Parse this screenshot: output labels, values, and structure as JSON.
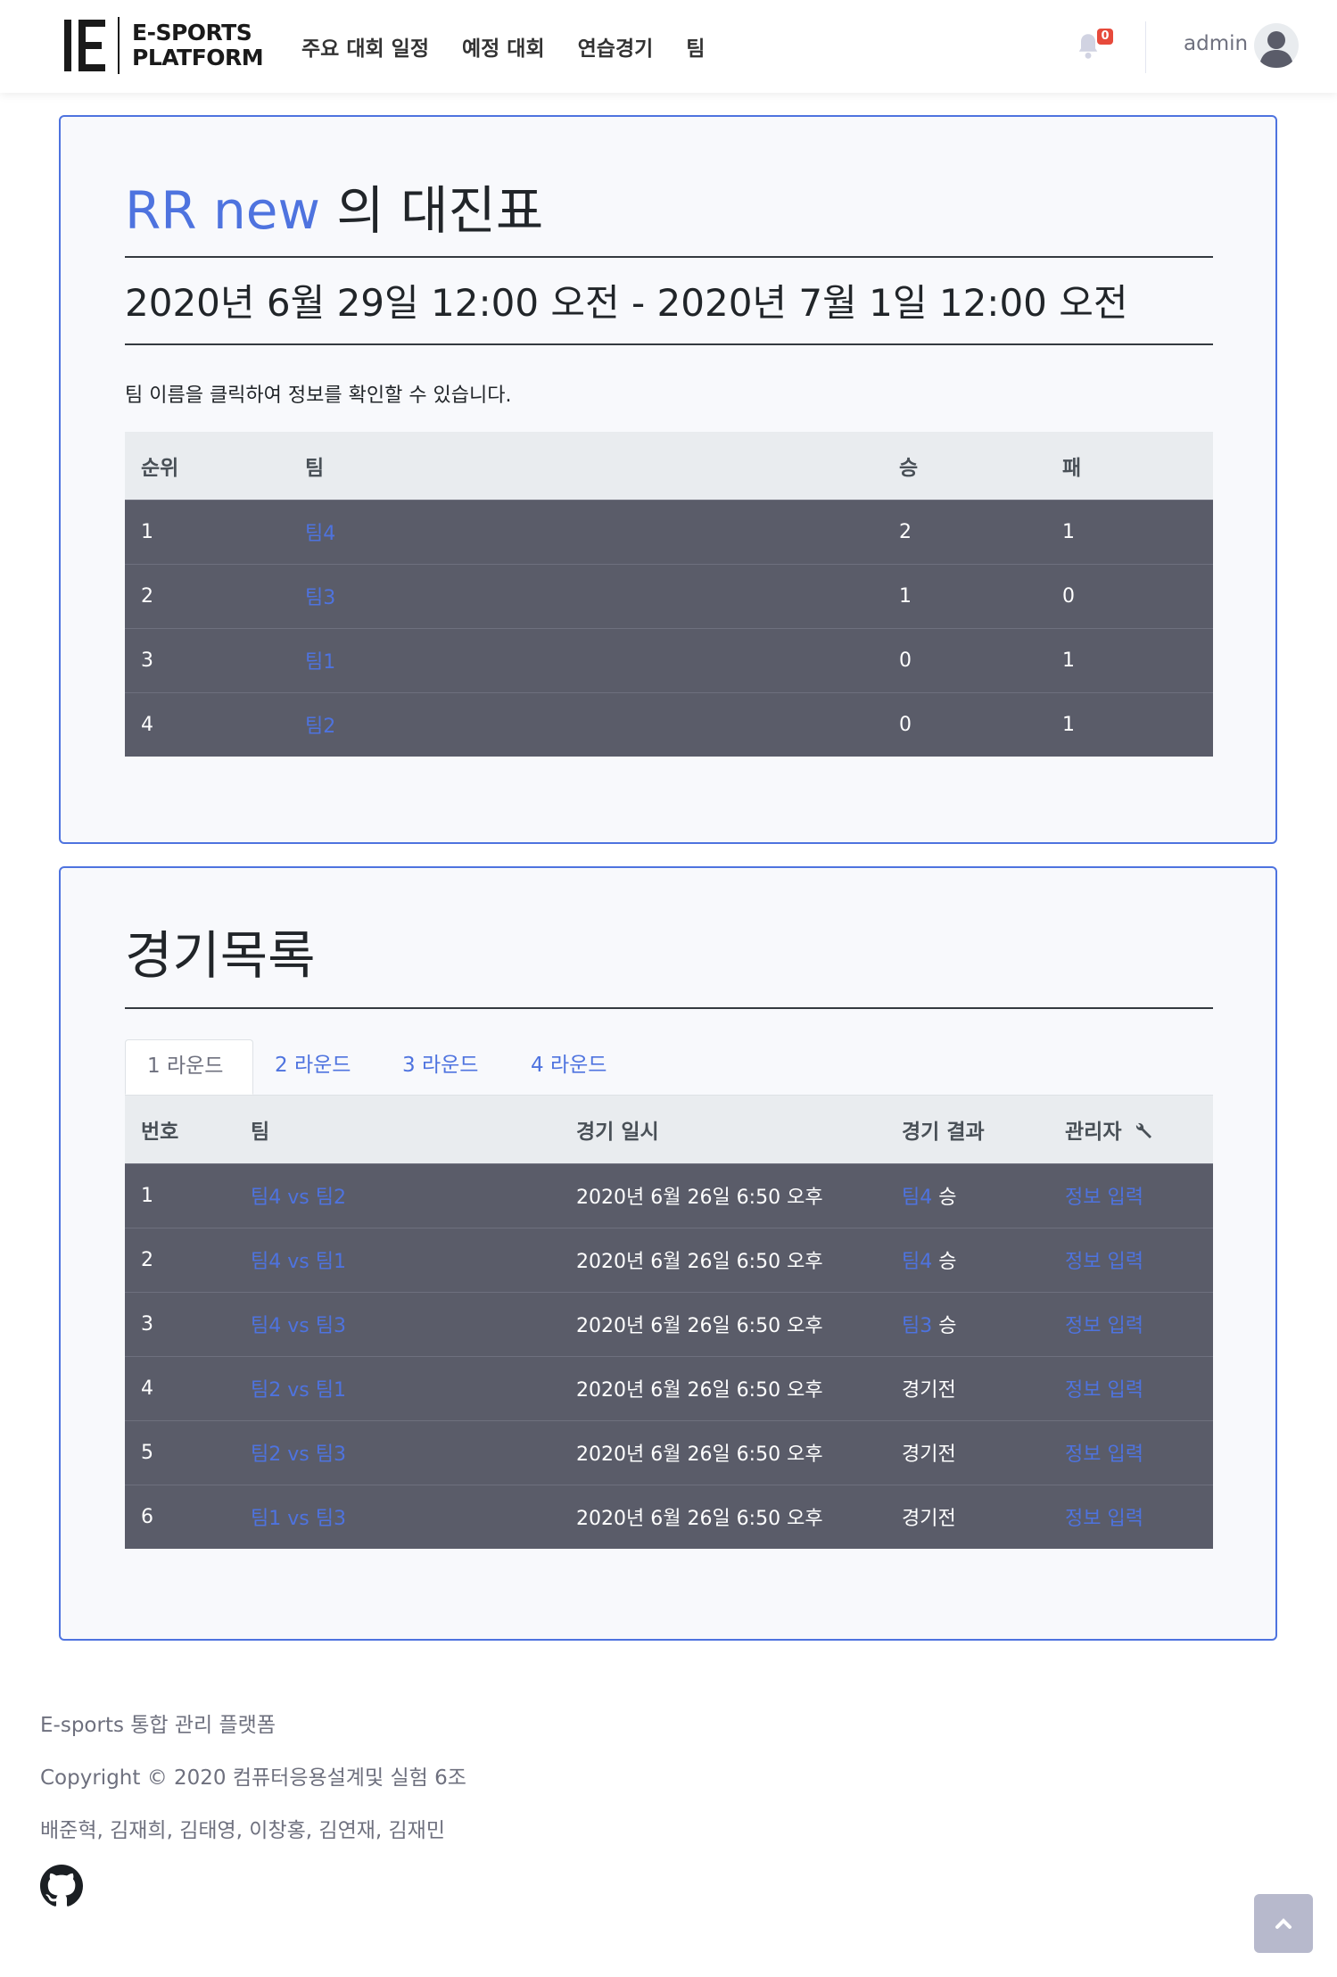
{
  "header": {
    "logo_line1": "E-SPORTS",
    "logo_line2": "PLATFORM",
    "nav": [
      "주요 대회 일정",
      "예정 대회",
      "연습경기",
      "팀"
    ],
    "notification_count": "0",
    "username": "admin"
  },
  "bracket": {
    "tournament_name": "RR new",
    "title_suffix": " 의 대진표",
    "date_range": "2020년 6월 29일 12:00 오전 - 2020년 7월 1일 12:00 오전",
    "hint": "팀 이름을 클릭하여 정보를 확인할 수 있습니다.",
    "columns": [
      "순위",
      "팀",
      "승",
      "패"
    ],
    "rows": [
      {
        "rank": "1",
        "team": "팀4",
        "wins": "2",
        "losses": "1"
      },
      {
        "rank": "2",
        "team": "팀3",
        "wins": "1",
        "losses": "0"
      },
      {
        "rank": "3",
        "team": "팀1",
        "wins": "0",
        "losses": "1"
      },
      {
        "rank": "4",
        "team": "팀2",
        "wins": "0",
        "losses": "1"
      }
    ]
  },
  "matches": {
    "title": "경기목록",
    "tabs": [
      "1 라운드",
      "2 라운드",
      "3 라운드",
      "4 라운드"
    ],
    "columns": [
      "번호",
      "팀",
      "경기 일시",
      "경기 결과",
      "관리자"
    ],
    "vs": "vs",
    "win_suffix": "승",
    "rows": [
      {
        "no": "1",
        "team_a": "팀4",
        "team_b": "팀2",
        "datetime": "2020년 6월 26일 6:50 오후",
        "winner": "팀4",
        "status": "",
        "action": "정보 입력"
      },
      {
        "no": "2",
        "team_a": "팀4",
        "team_b": "팀1",
        "datetime": "2020년 6월 26일 6:50 오후",
        "winner": "팀4",
        "status": "",
        "action": "정보 입력"
      },
      {
        "no": "3",
        "team_a": "팀4",
        "team_b": "팀3",
        "datetime": "2020년 6월 26일 6:50 오후",
        "winner": "팀3",
        "status": "",
        "action": "정보 입력"
      },
      {
        "no": "4",
        "team_a": "팀2",
        "team_b": "팀1",
        "datetime": "2020년 6월 26일 6:50 오후",
        "winner": "",
        "status": "경기전",
        "action": "정보 입력"
      },
      {
        "no": "5",
        "team_a": "팀2",
        "team_b": "팀3",
        "datetime": "2020년 6월 26일 6:50 오후",
        "winner": "",
        "status": "경기전",
        "action": "정보 입력"
      },
      {
        "no": "6",
        "team_a": "팀1",
        "team_b": "팀3",
        "datetime": "2020년 6월 26일 6:50 오후",
        "winner": "",
        "status": "경기전",
        "action": "정보 입력"
      }
    ]
  },
  "footer": {
    "line1": "E-sports 통합 관리 플랫폼",
    "line2": "Copyright © 2020 컴퓨터응용설계및 실험 6조",
    "line3": "배준혁, 김재희, 김태영, 이창홍, 김연재, 김재민"
  },
  "icons": {
    "bell": "bell-icon",
    "avatar": "user-avatar-icon",
    "wrench": "wrench-icon",
    "github": "github-icon",
    "scroll_top": "chevron-up-icon"
  },
  "colors": {
    "accent": "#4e73df",
    "table_row": "#5a5c69",
    "table_head": "#e9ecef",
    "badge": "#e74a3b"
  }
}
